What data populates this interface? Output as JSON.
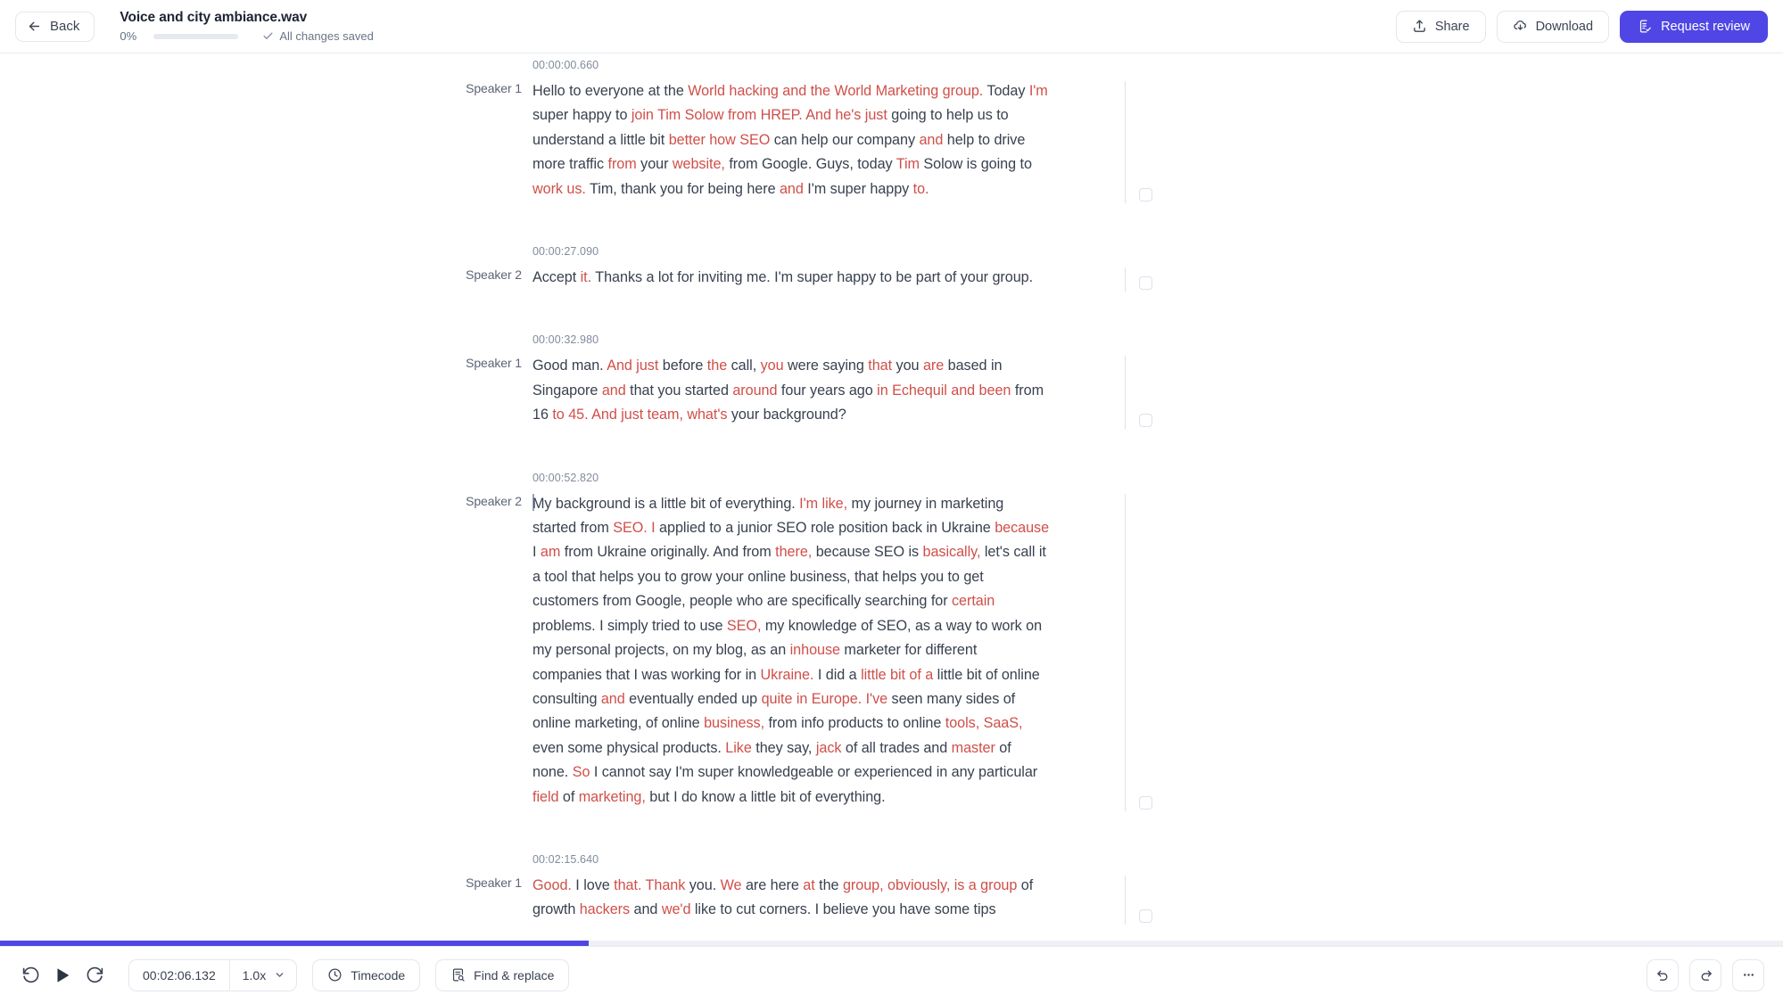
{
  "header": {
    "back_label": "Back",
    "file_title": "Voice and city ambiance.wav",
    "progress_percent_label": "0%",
    "progress_percent": 0,
    "saved_label": "All changes saved",
    "share_label": "Share",
    "download_label": "Download",
    "request_review_label": "Request review",
    "accent_color": "#4f46e5"
  },
  "transcript": {
    "low_confidence_color": "#d04f49",
    "text_color": "#39414f",
    "segments": [
      {
        "time": "00:00:00.660",
        "speaker": "Speaker 1",
        "text": "Hello to everyone at the World hacking and the World Marketing group. Today I'm super happy to join Tim Solow from HREP. And he's just going to help us to understand a little bit better how SEO can help our company and help to drive more traffic from your website, from Google. Guys, today Tim Solow is going to work us. Tim, thank you for being here and I'm super happy to.",
        "tokens": [
          {
            "t": "Hello to everyone at the ",
            "lo": false
          },
          {
            "t": "World hacking and the World Marketing group.",
            "lo": true
          },
          {
            "t": " Today ",
            "lo": false
          },
          {
            "t": "I'm",
            "lo": true
          },
          {
            "t": " super happy to ",
            "lo": false
          },
          {
            "t": "join Tim Solow from HREP. And he's just",
            "lo": true
          },
          {
            "t": " going to help us to understand a little bit ",
            "lo": false
          },
          {
            "t": "better how SEO",
            "lo": true
          },
          {
            "t": " can help our company ",
            "lo": false
          },
          {
            "t": "and",
            "lo": true
          },
          {
            "t": " help to drive more traffic ",
            "lo": false
          },
          {
            "t": "from",
            "lo": true
          },
          {
            "t": " your ",
            "lo": false
          },
          {
            "t": "website,",
            "lo": true
          },
          {
            "t": " from Google. Guys, today ",
            "lo": false
          },
          {
            "t": "Tim",
            "lo": true
          },
          {
            "t": " Solow is going to ",
            "lo": false
          },
          {
            "t": "work us.",
            "lo": true
          },
          {
            "t": " Tim, thank you for being here ",
            "lo": false
          },
          {
            "t": "and",
            "lo": true
          },
          {
            "t": " I'm super happy ",
            "lo": false
          },
          {
            "t": "to.",
            "lo": true
          }
        ]
      },
      {
        "time": "00:00:27.090",
        "speaker": "Speaker 2",
        "text": "Accept it. Thanks a lot for inviting me. I'm super happy to be part of your group.",
        "tokens": [
          {
            "t": "Accept ",
            "lo": false
          },
          {
            "t": "it.",
            "lo": true
          },
          {
            "t": " Thanks a lot for inviting me. I'm super happy to be part of your group.",
            "lo": false
          }
        ]
      },
      {
        "time": "00:00:32.980",
        "speaker": "Speaker 1",
        "text": "Good man. And just before the call, you were saying that you are based in Singapore and that you started around four years ago in Echequil and been from 16 to 45. And just team, what's your background?",
        "tokens": [
          {
            "t": "Good man. ",
            "lo": false
          },
          {
            "t": "And just",
            "lo": true
          },
          {
            "t": " before ",
            "lo": false
          },
          {
            "t": "the",
            "lo": true
          },
          {
            "t": " call, ",
            "lo": false
          },
          {
            "t": "you",
            "lo": true
          },
          {
            "t": " were saying ",
            "lo": false
          },
          {
            "t": "that",
            "lo": true
          },
          {
            "t": " you ",
            "lo": false
          },
          {
            "t": "are",
            "lo": true
          },
          {
            "t": " based in Singapore ",
            "lo": false
          },
          {
            "t": "and",
            "lo": true
          },
          {
            "t": " that you started ",
            "lo": false
          },
          {
            "t": "around",
            "lo": true
          },
          {
            "t": " four years ago ",
            "lo": false
          },
          {
            "t": "in Echequil and been",
            "lo": true
          },
          {
            "t": " from 16 ",
            "lo": false
          },
          {
            "t": "to 45. And just team, what's",
            "lo": true
          },
          {
            "t": " your background?",
            "lo": false
          }
        ]
      },
      {
        "time": "00:00:52.820",
        "speaker": "Speaker 2",
        "has_caret": true,
        "text": "My background is a little bit of everything. I'm like, my journey in marketing started from SEO. I applied to a junior SEO role position back in Ukraine because I am from Ukraine originally. And from there, because SEO is basically, let's call it a tool that helps you to grow your online business, that helps you to get customers from Google, people who are specifically searching for certain problems. I simply tried to use SEO, my knowledge of SEO, as a way to work on my personal projects, on my blog, as an inhouse marketer for different companies that I was working for in Ukraine. I did a little bit of a little bit of online consulting and eventually ended up quite in Europe. I've seen many sides of online marketing, of online business, from info products to online tools, SaaS, even some physical products. Like they say, jack of all trades and master of none. So I cannot say I'm super knowledgeable or experienced in any particular field of marketing, but I do know a little bit of everything.",
        "tokens": [
          {
            "t": "My background is a little bit of everything. ",
            "lo": false
          },
          {
            "t": "I'm like,",
            "lo": true
          },
          {
            "t": " my journey in marketing started from ",
            "lo": false
          },
          {
            "t": "SEO. I",
            "lo": true
          },
          {
            "t": " applied to a junior SEO role position back in Ukraine ",
            "lo": false
          },
          {
            "t": "because",
            "lo": true
          },
          {
            "t": " I ",
            "lo": false
          },
          {
            "t": "am",
            "lo": true
          },
          {
            "t": " from Ukraine originally. And from ",
            "lo": false
          },
          {
            "t": "there,",
            "lo": true
          },
          {
            "t": " because SEO is ",
            "lo": false
          },
          {
            "t": "basically,",
            "lo": true
          },
          {
            "t": " let's call it a tool that helps you to grow your online business, that helps you to get customers from Google, people who are specifically searching for ",
            "lo": false
          },
          {
            "t": "certain",
            "lo": true
          },
          {
            "t": " problems. I simply tried to use ",
            "lo": false
          },
          {
            "t": "SEO,",
            "lo": true
          },
          {
            "t": " my knowledge of SEO, as a way to work on my personal projects, on my blog, as an ",
            "lo": false
          },
          {
            "t": "inhouse",
            "lo": true
          },
          {
            "t": " marketer for different companies that I was working for in ",
            "lo": false
          },
          {
            "t": "Ukraine.",
            "lo": true
          },
          {
            "t": " I did a ",
            "lo": false
          },
          {
            "t": "little bit of a",
            "lo": true
          },
          {
            "t": " little bit of online consulting ",
            "lo": false
          },
          {
            "t": "and",
            "lo": true
          },
          {
            "t": " eventually ended up ",
            "lo": false
          },
          {
            "t": "quite in Europe. I've",
            "lo": true
          },
          {
            "t": " seen many sides of online marketing, of online ",
            "lo": false
          },
          {
            "t": "business,",
            "lo": true
          },
          {
            "t": " from info products to online ",
            "lo": false
          },
          {
            "t": "tools, SaaS,",
            "lo": true
          },
          {
            "t": " even some physical products. ",
            "lo": false
          },
          {
            "t": "Like",
            "lo": true
          },
          {
            "t": " they say, ",
            "lo": false
          },
          {
            "t": "jack",
            "lo": true
          },
          {
            "t": " of all trades and ",
            "lo": false
          },
          {
            "t": "master",
            "lo": true
          },
          {
            "t": " of none. ",
            "lo": false
          },
          {
            "t": "So",
            "lo": true
          },
          {
            "t": " I cannot say I'm super knowledgeable or experienced in any particular ",
            "lo": false
          },
          {
            "t": "field",
            "lo": true
          },
          {
            "t": " of ",
            "lo": false
          },
          {
            "t": "marketing,",
            "lo": true
          },
          {
            "t": " but I do know a little bit of everything.",
            "lo": false
          }
        ]
      },
      {
        "time": "00:02:15.640",
        "speaker": "Speaker 1",
        "text": "Good. I love that. Thank you. We are here at the group, obviously, is a group of growth hackers and we'd like to cut corners. I believe you have some tips",
        "tokens": [
          {
            "t": "Good.",
            "lo": true
          },
          {
            "t": " I love ",
            "lo": false
          },
          {
            "t": "that. Thank",
            "lo": true
          },
          {
            "t": " you. ",
            "lo": false
          },
          {
            "t": "We",
            "lo": true
          },
          {
            "t": " are here ",
            "lo": false
          },
          {
            "t": "at",
            "lo": true
          },
          {
            "t": " the ",
            "lo": false
          },
          {
            "t": "group, obviously, is a group",
            "lo": true
          },
          {
            "t": " of growth ",
            "lo": false
          },
          {
            "t": "hackers",
            "lo": true
          },
          {
            "t": " and ",
            "lo": false
          },
          {
            "t": "we'd",
            "lo": true
          },
          {
            "t": " like to cut corners. I believe you have some tips",
            "lo": false
          }
        ]
      }
    ]
  },
  "playbar": {
    "seek_percent": 33,
    "current_time": "00:02:06.132",
    "speed": "1.0x",
    "timecode_label": "Timecode",
    "find_replace_label": "Find & replace"
  }
}
